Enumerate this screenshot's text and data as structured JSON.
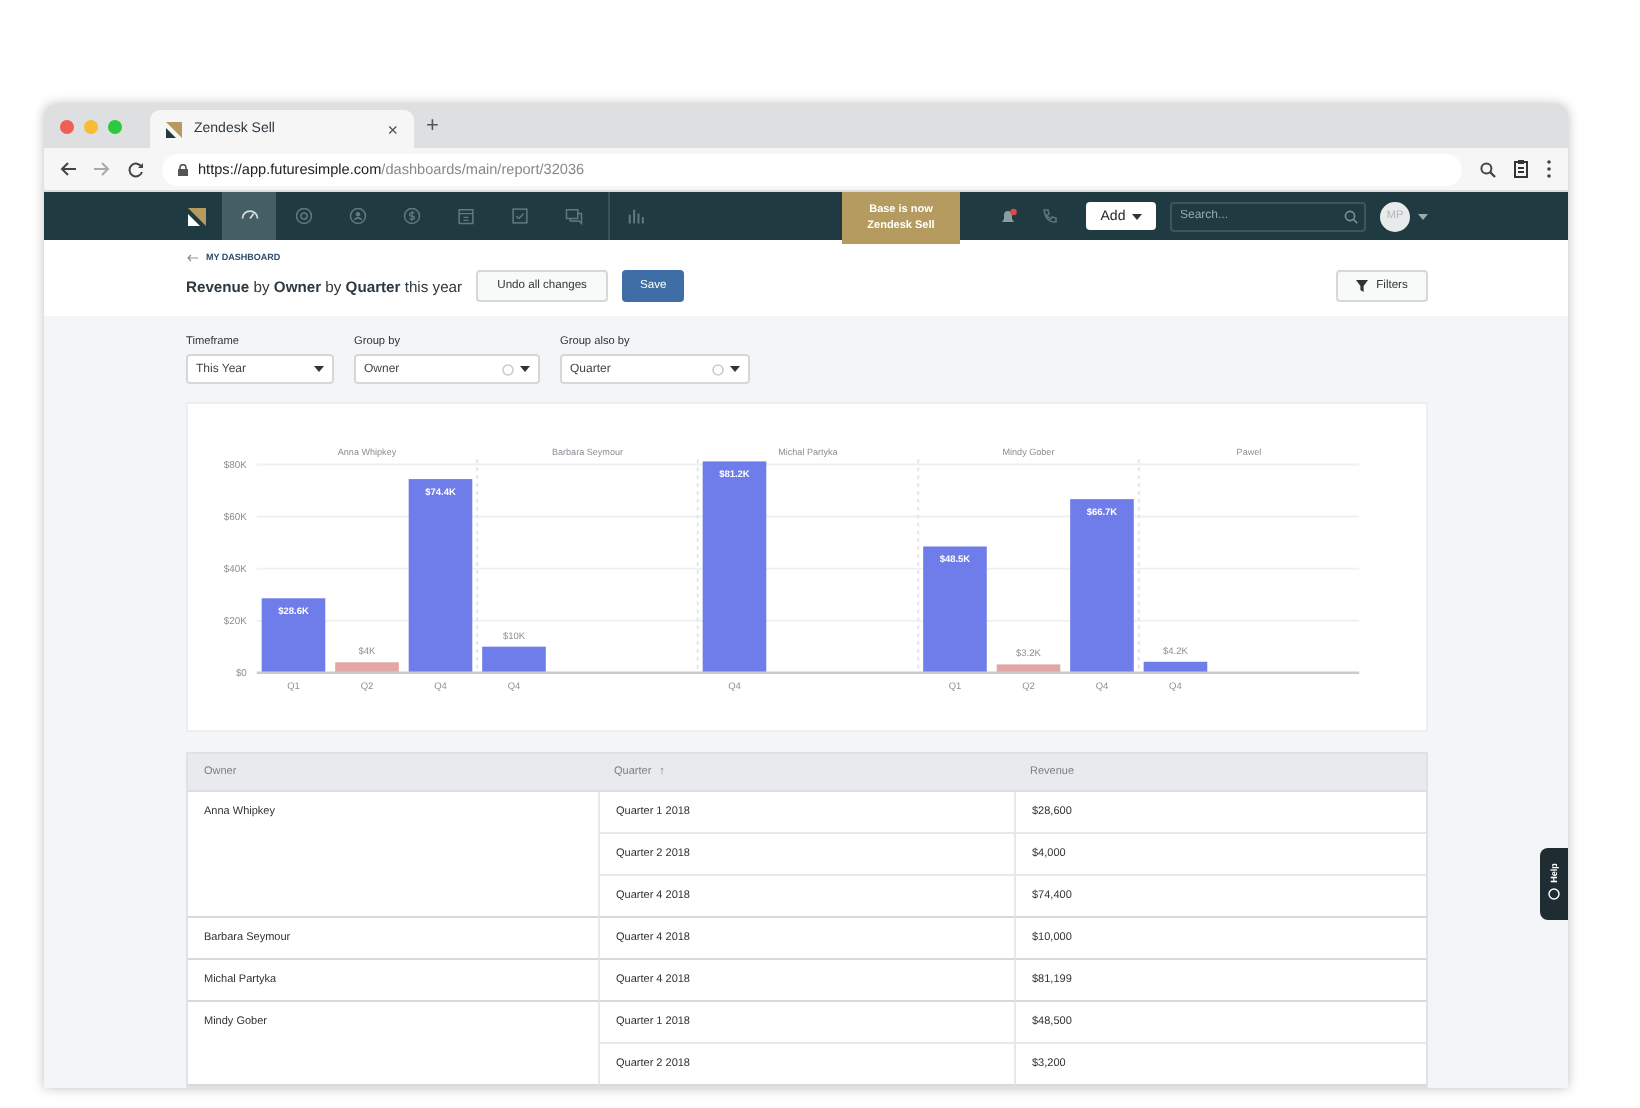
{
  "browser": {
    "tab": {
      "title": "Zendesk Sell",
      "close": "×"
    },
    "new_tab": "+",
    "url": {
      "host": "https://app.futuresimple.com",
      "path": "/dashboards/main/report/32036"
    }
  },
  "nav": {
    "items": [
      {
        "kind": "dashboard",
        "selected": true
      },
      {
        "kind": "leads",
        "selected": false
      },
      {
        "kind": "contacts",
        "selected": false
      },
      {
        "kind": "deals",
        "selected": false
      },
      {
        "kind": "calendar",
        "selected": false
      },
      {
        "kind": "tasks",
        "selected": false
      },
      {
        "kind": "messages",
        "selected": false
      },
      {
        "kind": "reports",
        "selected": false
      }
    ],
    "banner": "Base is now Zendesk Sell",
    "bell": {
      "unread": true
    },
    "add_button": "Add",
    "search": {
      "placeholder": "Search..."
    },
    "avatar": "MP"
  },
  "header": {
    "back_link": "MY DASHBOARD",
    "title": "**Revenue** by **Owner** by **Quarter** this year",
    "buttons": [
      {
        "label": "Undo all changes",
        "kind": "secondary"
      },
      {
        "label": "Save",
        "kind": "primary"
      }
    ],
    "filters_button": "Filters"
  },
  "selectors": [
    {
      "label": "Timeframe",
      "value": "This Year",
      "clearable": false
    },
    {
      "label": "Group by",
      "value": "Owner",
      "clearable": true
    },
    {
      "label": "Group also by",
      "value": "Quarter",
      "clearable": true
    }
  ],
  "chart": {
    "owners": [
      {
        "name": "Anna Whipkey"
      },
      {
        "name": "Barbara Seymour"
      },
      {
        "name": "Michal Partyka"
      },
      {
        "name": "Mindy Gober"
      },
      {
        "name": "Pawel"
      }
    ],
    "chart_data": {
      "type": "bar",
      "categories": [
        "Q1",
        "Q2",
        "Q4",
        "Q4",
        null,
        null,
        "Q4",
        null,
        null,
        "Q1",
        "Q2",
        "Q4",
        "Q4",
        null,
        null
      ],
      "series": [
        {
          "color": "#6f7deb",
          "values": [
            28600,
            null,
            74400,
            10000,
            null,
            null,
            81200,
            null,
            null,
            48500,
            null,
            66700,
            4200,
            null,
            null
          ]
        },
        {
          "color": "#e3a6a6",
          "values": [
            null,
            4000,
            null,
            null,
            null,
            null,
            null,
            null,
            null,
            null,
            3200,
            null,
            null,
            null,
            null
          ]
        }
      ],
      "ylim": [
        0,
        82000
      ],
      "grid": true,
      "yticks": [
        {
          "value": 0,
          "label": "$0"
        },
        {
          "value": 20000,
          "label": "$20K"
        },
        {
          "value": 40000,
          "label": "$40K"
        },
        {
          "value": 60000,
          "label": "$60K"
        },
        {
          "value": 80000,
          "label": "$80K"
        }
      ],
      "value_labels": [
        "$28.6K",
        "$4K",
        "$74.4K",
        "$10K",
        null,
        null,
        "$81.2K",
        null,
        null,
        "$48.5K",
        "$3.2K",
        "$66.7K",
        "$4.2K",
        null,
        null
      ]
    }
  },
  "table": {
    "columns": [
      {
        "label": "Owner"
      },
      {
        "label": "Quarter",
        "sort": "↑"
      },
      {
        "label": "Revenue"
      }
    ],
    "groups": [
      {
        "owner": "Anna Whipkey",
        "rows": [
          {
            "quarter": "Quarter 1 2018",
            "revenue": "$28,600"
          },
          {
            "quarter": "Quarter 2 2018",
            "revenue": "$4,000"
          },
          {
            "quarter": "Quarter 4 2018",
            "revenue": "$74,400"
          }
        ]
      },
      {
        "owner": "Barbara Seymour",
        "rows": [
          {
            "quarter": "Quarter 4 2018",
            "revenue": "$10,000"
          }
        ]
      },
      {
        "owner": "Michal Partyka",
        "rows": [
          {
            "quarter": "Quarter 4 2018",
            "revenue": "$81,199"
          }
        ]
      },
      {
        "owner": "Mindy Gober",
        "rows": [
          {
            "quarter": "Quarter 1 2018",
            "revenue": "$48,500"
          },
          {
            "quarter": "Quarter 2 2018",
            "revenue": "$3,200"
          }
        ]
      }
    ]
  },
  "help": {
    "label": "Help"
  }
}
